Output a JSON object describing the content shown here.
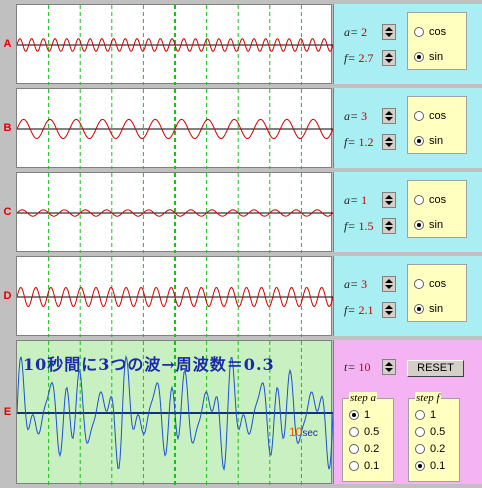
{
  "rows": [
    {
      "label": "A",
      "a": "2",
      "f": "2.7",
      "fn": "sin",
      "cos_label": "cos",
      "sin_label": "sin"
    },
    {
      "label": "B",
      "a": "3",
      "f": "1.2",
      "fn": "sin",
      "cos_label": "cos",
      "sin_label": "sin"
    },
    {
      "label": "C",
      "a": "1",
      "f": "1.5",
      "fn": "sin",
      "cos_label": "cos",
      "sin_label": "sin"
    },
    {
      "label": "D",
      "a": "3",
      "f": "2.1",
      "fn": "sin",
      "cos_label": "cos",
      "sin_label": "sin"
    }
  ],
  "param_a_label": "a=",
  "param_f_label": "f=",
  "sum": {
    "label": "E",
    "message": "10秒間に3つの波→周波数＝0.3",
    "t_label": "t=",
    "t_value": "10",
    "reset_label": "RESET",
    "sec_num": "10",
    "sec_unit": "sec",
    "step_a": {
      "title": "step a",
      "options": [
        "1",
        "0.5",
        "0.2",
        "0.1"
      ],
      "selected": "1"
    },
    "step_f": {
      "title": "step f",
      "options": [
        "1",
        "0.5",
        "0.2",
        "0.1"
      ],
      "selected": "0.1"
    }
  },
  "colors": {
    "wave": "#d00000",
    "axis": "#000000",
    "grid": "#18c018",
    "sum": "#2050d0",
    "sum_bg": "#c8f0c0"
  }
}
